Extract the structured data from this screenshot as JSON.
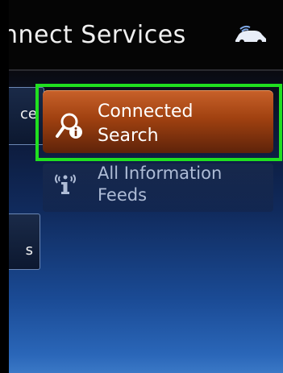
{
  "header": {
    "title": "nnect Services",
    "status_icon": "car-connection-icon"
  },
  "side_buttons": [
    {
      "label": "ce"
    },
    {
      "label": "s"
    }
  ],
  "menu": {
    "connected_search": {
      "line1": "Connected",
      "line2": "Search",
      "icon": "search-info-icon"
    },
    "all_information_feeds": {
      "line1": "All Information",
      "line2": "Feeds",
      "icon": "info-signal-icon"
    }
  },
  "colors": {
    "selection_outline": "#20e020",
    "selected_button": "#a04110",
    "background_top": "#070707",
    "background_bottom": "#3a78c6"
  }
}
